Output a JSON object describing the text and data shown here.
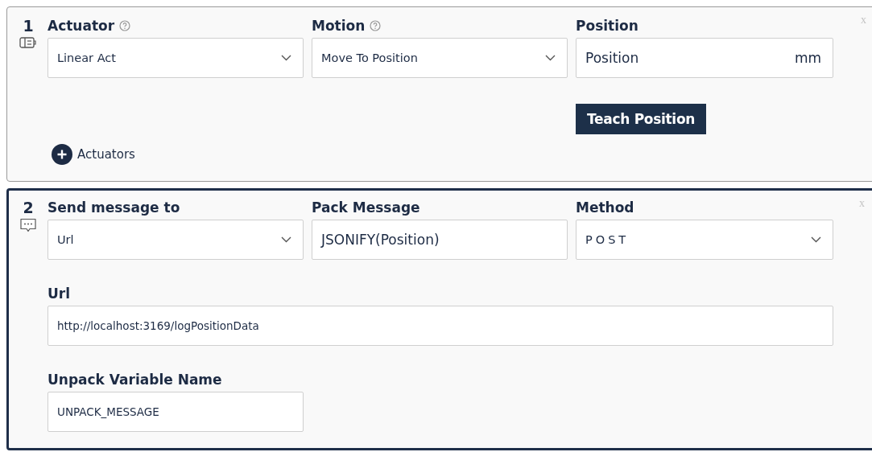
{
  "steps": [
    {
      "number": "1",
      "selected": false,
      "kind": "actuator",
      "close": "x",
      "rows": [
        [
          {
            "label": "Actuator",
            "help": true,
            "kind": "select",
            "value": "Linear Act"
          },
          {
            "label": "Motion",
            "help": true,
            "kind": "select",
            "value": "Move To Position"
          },
          {
            "label": "Position",
            "help": false,
            "kind": "input",
            "value": "Position",
            "unit": "mm",
            "button": "Teach Position"
          }
        ]
      ],
      "add_link": "Actuators"
    },
    {
      "number": "2",
      "selected": true,
      "kind": "message",
      "close": "x",
      "rows": [
        [
          {
            "label": "Send message to",
            "help": false,
            "kind": "select",
            "value": "Url"
          },
          {
            "label": "Pack Message",
            "help": false,
            "kind": "input",
            "value": "JSONIFY(Position)"
          },
          {
            "label": "Method",
            "help": false,
            "kind": "spaced-select",
            "value": "POST"
          }
        ],
        [
          {
            "label": "Url",
            "help": false,
            "kind": "wide-text",
            "value": "http://localhost:3169/logPositionData"
          }
        ],
        [
          {
            "label": "Unpack Variable Name",
            "help": false,
            "kind": "text",
            "value": "UNPACK_MESSAGE"
          }
        ]
      ]
    }
  ]
}
